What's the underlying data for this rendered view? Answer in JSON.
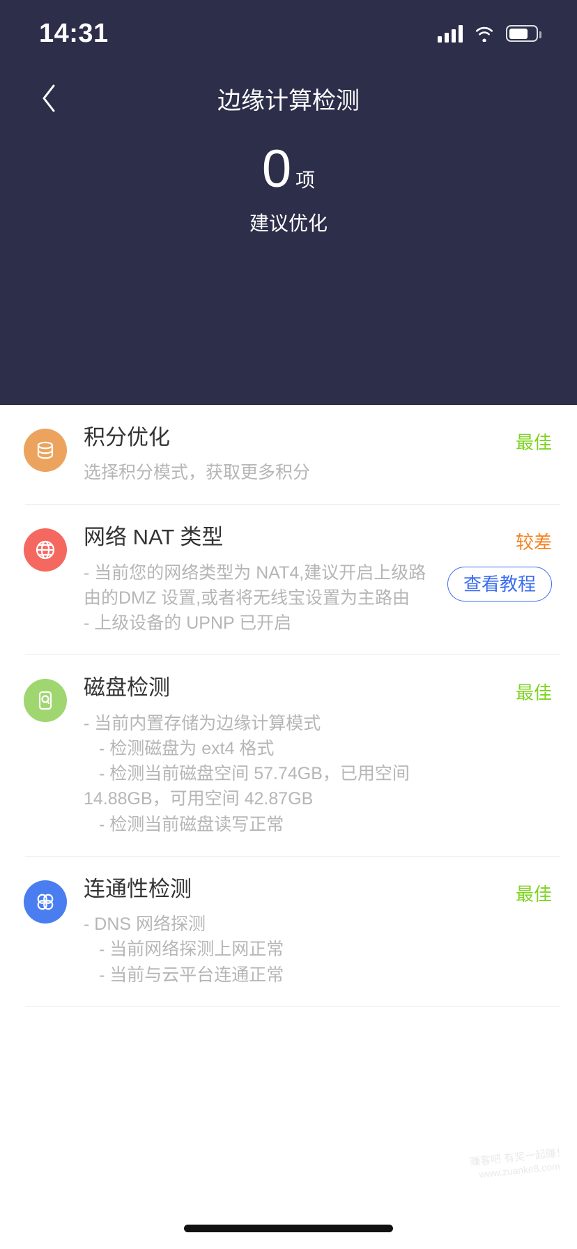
{
  "statusbar": {
    "time": "14:31",
    "signal_icon": "cellular-signal-icon",
    "wifi_icon": "wifi-icon",
    "battery_icon": "battery-icon"
  },
  "navbar": {
    "back_icon": "chevron-left-icon",
    "title": "边缘计算检测"
  },
  "hero": {
    "count": "0",
    "unit": "项",
    "subtitle": "建议优化",
    "background_color": "#2c2e4a"
  },
  "colors": {
    "good": "#7ed321",
    "bad": "#f5811f",
    "link": "#3a6df0",
    "icon_points": "#eba35d",
    "icon_nat": "#f4685f",
    "icon_disk": "#9fd66f",
    "icon_conn": "#4a7ef0"
  },
  "items": [
    {
      "icon": "database-icon",
      "icon_color": "#eba35d",
      "title": "积分优化",
      "lines": [
        "选择积分模式，获取更多积分"
      ],
      "indent": [
        false
      ],
      "status": "最佳",
      "status_type": "good",
      "button": null
    },
    {
      "icon": "globe-icon",
      "icon_color": "#f4685f",
      "title": "网络 NAT 类型",
      "lines": [
        "- 当前您的网络类型为 NAT4,建议开启上级路由的DMZ 设置,或者将无线宝设置为主路由",
        "- 上级设备的 UPNP 已开启"
      ],
      "indent": [
        false,
        false
      ],
      "status": "较差",
      "status_type": "bad",
      "button": "查看教程"
    },
    {
      "icon": "hard-disk-icon",
      "icon_color": "#9fd66f",
      "title": "磁盘检测",
      "lines": [
        "- 当前内置存储为边缘计算模式",
        "- 检测磁盘为 ext4 格式",
        "- 检测当前磁盘空间 57.74GB，已用空间 14.88GB，可用空间 42.87GB",
        "- 检测当前磁盘读写正常"
      ],
      "indent": [
        false,
        true,
        true,
        true
      ],
      "status": "最佳",
      "status_type": "good",
      "button": null
    },
    {
      "icon": "connectivity-icon",
      "icon_color": "#4a7ef0",
      "title": "连通性检测",
      "lines": [
        "- DNS 网络探测",
        "- 当前网络探测上网正常",
        "- 当前与云平台连通正常"
      ],
      "indent": [
        false,
        true,
        true
      ],
      "status": "最佳",
      "status_type": "good",
      "button": null
    }
  ],
  "watermark": {
    "line1": "赚客吧  有奖一起赚！",
    "line2": "www.zuanke8.com"
  }
}
